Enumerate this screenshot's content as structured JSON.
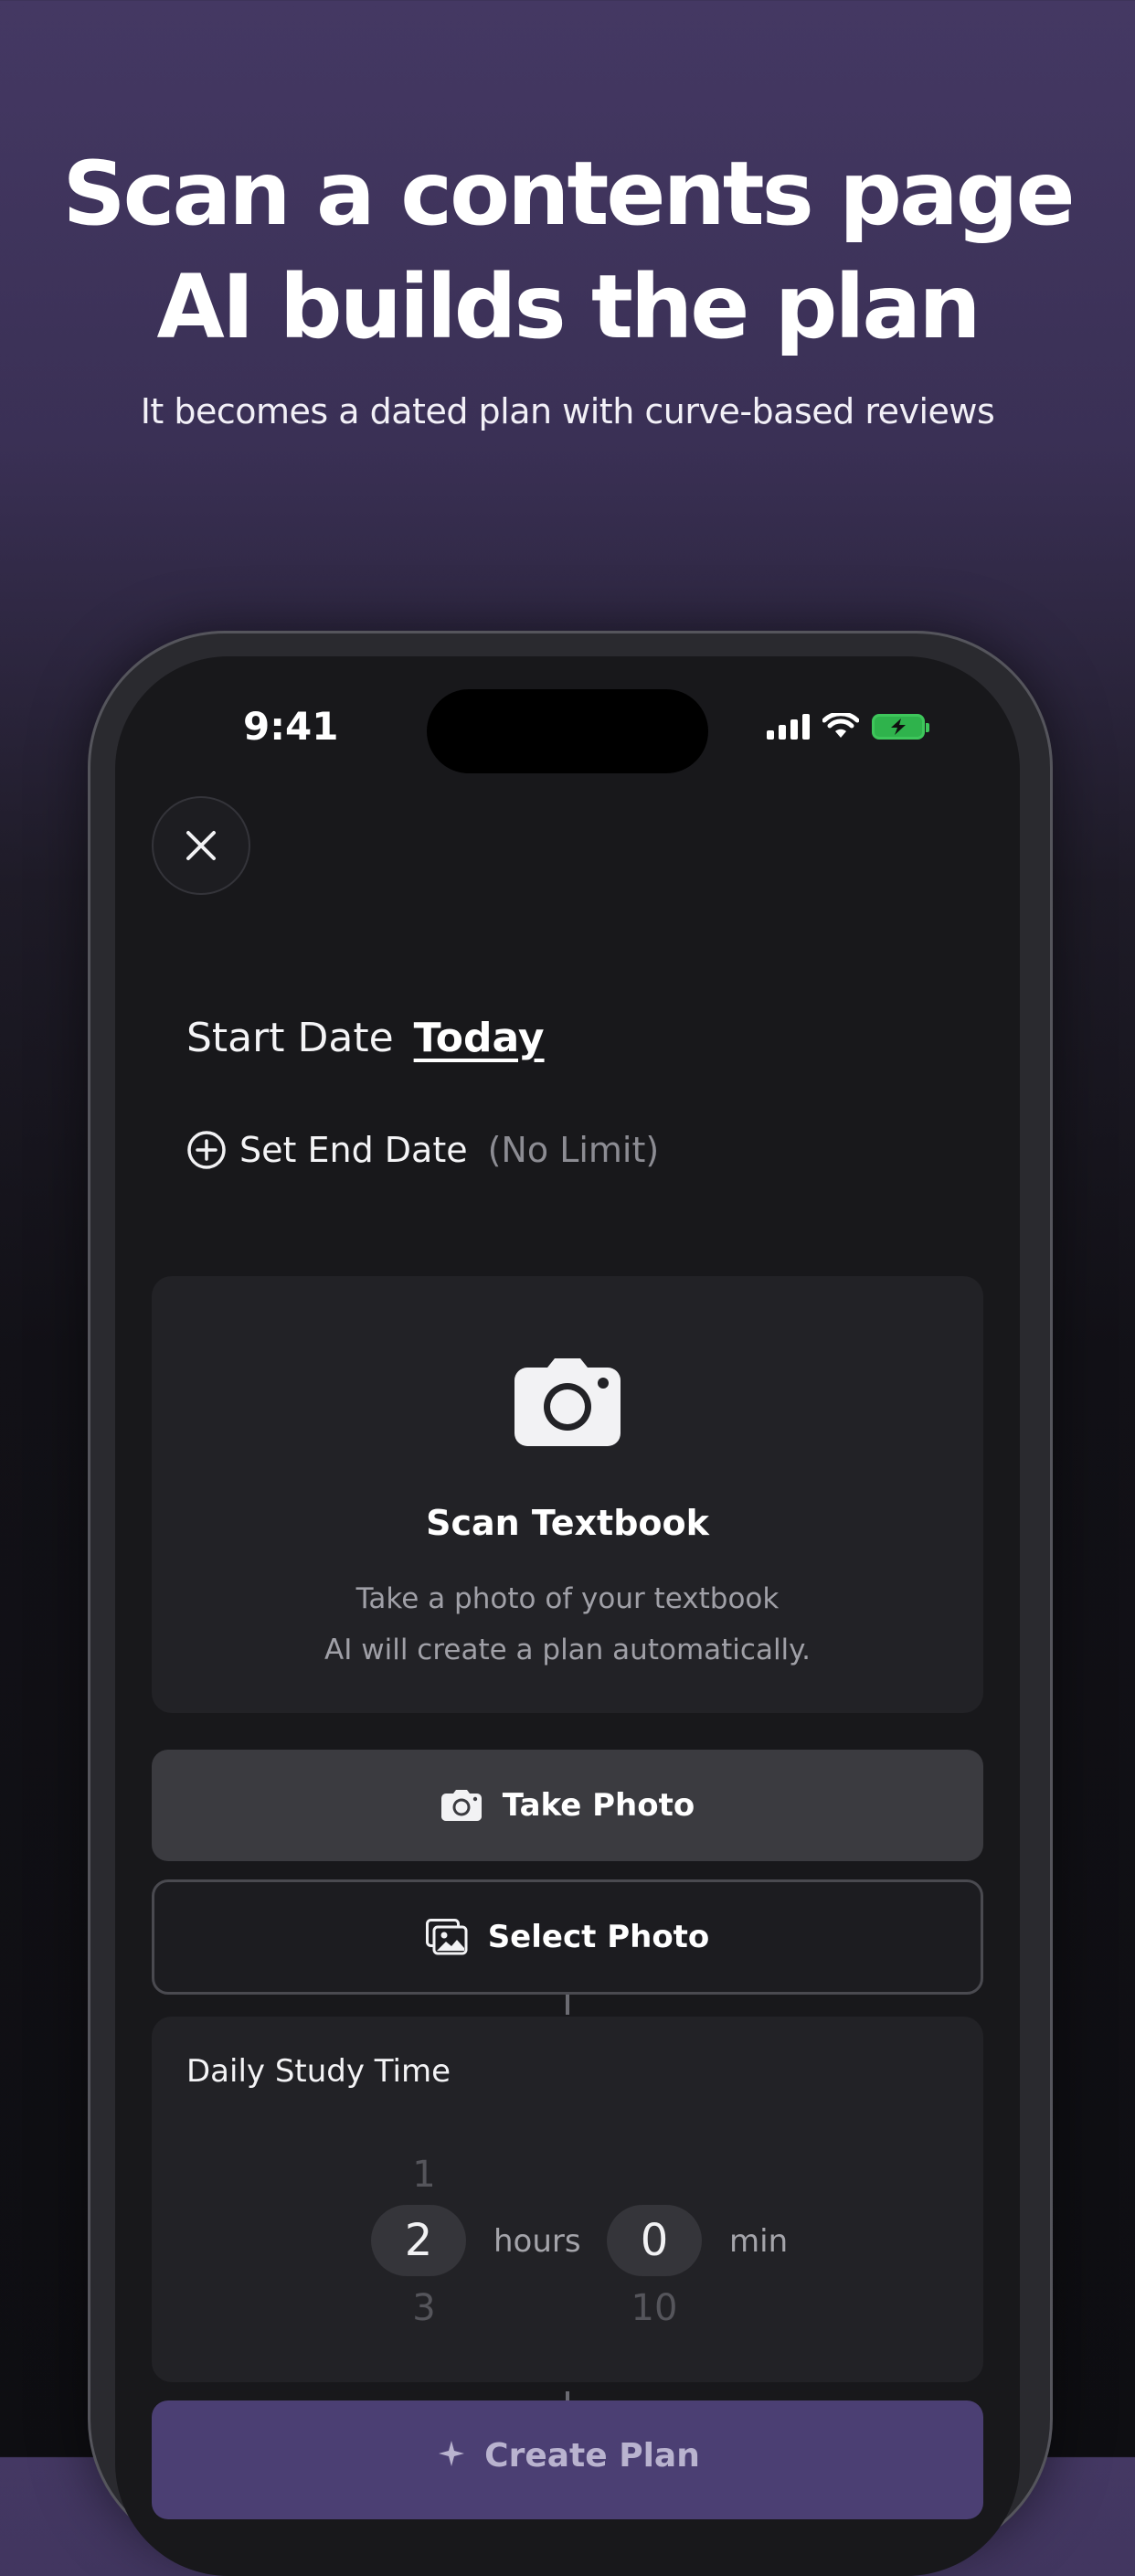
{
  "promo": {
    "headline_line1": "Scan a contents page",
    "headline_line2": "AI builds the plan",
    "subheadline": "It becomes a dated plan with curve-based reviews"
  },
  "status_bar": {
    "time": "9:41",
    "battery_state": "charging",
    "icons": [
      "signal-icon",
      "wifi-icon",
      "battery-charging-icon"
    ]
  },
  "close_button": {
    "icon": "close-icon"
  },
  "start_date": {
    "label": "Start Date",
    "value": "Today"
  },
  "end_date": {
    "label": "Set End Date",
    "hint": "(No Limit)",
    "icon": "plus-circle-icon"
  },
  "scan_card": {
    "icon": "camera-icon",
    "title": "Scan Textbook",
    "description_line1": "Take a photo of your textbook",
    "description_line2": "AI will create a plan automatically."
  },
  "take_photo": {
    "label": "Take Photo",
    "icon": "camera-icon"
  },
  "select_photo": {
    "label": "Select Photo",
    "icon": "photo-library-icon"
  },
  "daily_study_time": {
    "title": "Daily Study Time",
    "hours": {
      "above": "1",
      "selected": "2",
      "below": "3",
      "unit": "hours"
    },
    "minutes": {
      "above": "",
      "selected": "0",
      "below": "10",
      "unit": "min"
    }
  },
  "create_plan": {
    "label": "Create Plan",
    "icon": "sparkle-icon"
  },
  "colors": {
    "accent": "#4b3f73",
    "battery": "#3ec65b",
    "background_top": "#443863",
    "surface": "#222226"
  }
}
